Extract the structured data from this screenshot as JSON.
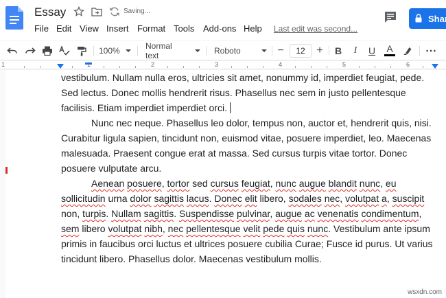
{
  "header": {
    "title": "Essay",
    "saving_status": "Saving...",
    "last_edit": "Last edit was second...",
    "share_label": "Shar"
  },
  "menu": [
    "File",
    "Edit",
    "View",
    "Insert",
    "Format",
    "Tools",
    "Add-ons",
    "Help"
  ],
  "toolbar": {
    "zoom": "100%",
    "style": "Normal text",
    "font": "Roboto",
    "font_size": "12",
    "decrease": "−",
    "increase": "+",
    "bold": "B",
    "italic": "I",
    "underline": "U",
    "text_color": "A",
    "more": "⋯"
  },
  "ruler": [
    "1",
    "1",
    "2",
    "3",
    "4",
    "5",
    "6"
  ],
  "colors": {
    "accent": "#1a73e8",
    "doc_icon": "#4285f4",
    "spell": "#d93025"
  },
  "document": {
    "para1_lines": [
      "vestibulum. Nullam nulla eros, ultricies sit amet, nonummy id, imperdiet feugiat, pede.",
      "Sed lectus. Donec mollis hendrerit risus. Phasellus nec sem in justo pellentesque",
      "facilisis. Etiam imperdiet imperdiet orci."
    ],
    "para2": "Nunc nec neque. Phasellus leo dolor, tempus non, auctor et, hendrerit quis, nisi. Curabitur ligula sapien, tincidunt non, euismod vitae, posuere imperdiet, leo. Maecenas malesuada. Praesent congue erat at massa. Sed cursus turpis vitae tortor. Donec posuere vulputate arcu.",
    "para3_words": [
      {
        "t": "Aenean",
        "s": true
      },
      {
        "t": " "
      },
      {
        "t": "posuere",
        "s": true
      },
      {
        "t": ", "
      },
      {
        "t": "tortor",
        "s": true
      },
      {
        "t": " sed "
      },
      {
        "t": "cursus",
        "s": true
      },
      {
        "t": " "
      },
      {
        "t": "feugiat",
        "s": true
      },
      {
        "t": ", "
      },
      {
        "t": "nunc",
        "s": true
      },
      {
        "t": " "
      },
      {
        "t": "augue",
        "s": true
      },
      {
        "t": " "
      },
      {
        "t": "blandit",
        "s": true
      },
      {
        "t": " "
      },
      {
        "t": "nunc",
        "s": true
      },
      {
        "t": ", "
      },
      {
        "t": "eu",
        "s": true
      },
      {
        "t": " "
      },
      {
        "t": "sollicitudin",
        "s": true
      },
      {
        "t": " urna "
      },
      {
        "t": "dolor",
        "s": true
      },
      {
        "t": " "
      },
      {
        "t": "sagittis",
        "s": true
      },
      {
        "t": " "
      },
      {
        "t": "lacus",
        "s": true
      },
      {
        "t": ". "
      },
      {
        "t": "Donec",
        "s": true
      },
      {
        "t": " "
      },
      {
        "t": "elit",
        "s": true
      },
      {
        "t": " libero, "
      },
      {
        "t": "sodales",
        "s": true
      },
      {
        "t": " "
      },
      {
        "t": "nec",
        "s": true
      },
      {
        "t": ", "
      },
      {
        "t": "volutpat",
        "s": true
      },
      {
        "t": " "
      },
      {
        "t": "a",
        "s": true
      },
      {
        "t": ", "
      },
      {
        "t": "suscipit",
        "s": true
      },
      {
        "t": " non, "
      },
      {
        "t": "turpis",
        "s": true
      },
      {
        "t": ". "
      },
      {
        "t": "Nullam",
        "s": true
      },
      {
        "t": " "
      },
      {
        "t": "sagittis",
        "s": true
      },
      {
        "t": ". "
      },
      {
        "t": "Suspendisse",
        "s": true
      },
      {
        "t": " "
      },
      {
        "t": "pulvinar",
        "s": true
      },
      {
        "t": ", "
      },
      {
        "t": "augue",
        "s": true
      },
      {
        "t": " "
      },
      {
        "t": "ac",
        "s": true
      },
      {
        "t": " "
      },
      {
        "t": "venenatis",
        "s": true
      },
      {
        "t": " "
      },
      {
        "t": "condimentum",
        "s": true
      },
      {
        "t": ", "
      },
      {
        "t": "sem",
        "s": true
      },
      {
        "t": " libero "
      },
      {
        "t": "volutpat",
        "s": true
      },
      {
        "t": " "
      },
      {
        "t": "nibh",
        "s": true
      },
      {
        "t": ", "
      },
      {
        "t": "nec",
        "s": true
      },
      {
        "t": " "
      },
      {
        "t": "pellentesque",
        "s": true
      },
      {
        "t": " "
      },
      {
        "t": "velit",
        "s": true
      },
      {
        "t": " "
      },
      {
        "t": "pede",
        "s": true
      },
      {
        "t": " "
      },
      {
        "t": "quis",
        "s": true
      },
      {
        "t": " "
      },
      {
        "t": "nunc",
        "s": true
      },
      {
        "t": ". Vestibulum ante ipsum primis in faucibus orci luctus et ultrices posuere cubilia Curae; Fusce id purus. Ut varius tincidunt libero. Phasellus dolor. Maecenas vestibulum mollis."
      }
    ]
  },
  "watermark": "wsxdn.com"
}
